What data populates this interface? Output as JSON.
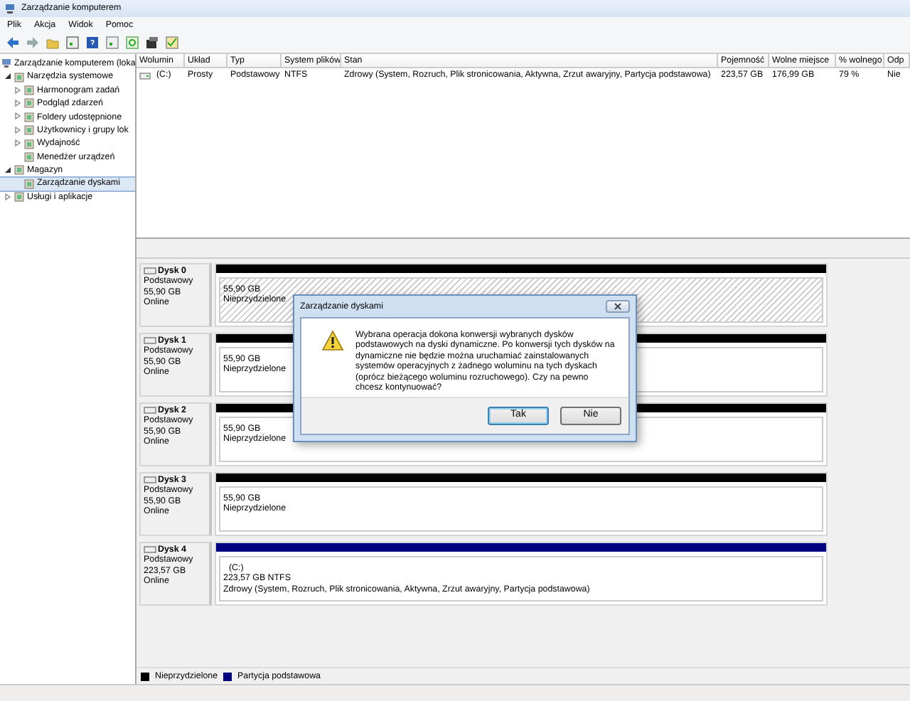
{
  "window": {
    "title": "Zarządzanie komputerem"
  },
  "menu": [
    "Plik",
    "Akcja",
    "Widok",
    "Pomoc"
  ],
  "tree": [
    {
      "label": "Zarządzanie komputerem (loka",
      "kind": "root",
      "selected": false,
      "children": [
        {
          "label": "Narzędzia systemowe",
          "kind": "group",
          "expanded": true,
          "selected": false,
          "children": [
            {
              "label": "Harmonogram zadań",
              "kind": "group",
              "expanded": false,
              "selected": false
            },
            {
              "label": "Podgląd zdarzeń",
              "kind": "group",
              "expanded": false,
              "selected": false
            },
            {
              "label": "Foldery udostępnione",
              "kind": "group",
              "expanded": false,
              "selected": false
            },
            {
              "label": "Użytkownicy i grupy lok",
              "kind": "group",
              "expanded": false,
              "selected": false
            },
            {
              "label": "Wydajność",
              "kind": "group",
              "expanded": false,
              "selected": false
            },
            {
              "label": "Menedżer urządzeń",
              "kind": "leaf",
              "selected": false
            }
          ]
        },
        {
          "label": "Magazyn",
          "kind": "group",
          "expanded": true,
          "selected": false,
          "children": [
            {
              "label": "Zarządzanie dyskami",
              "kind": "leaf",
              "selected": true
            }
          ]
        },
        {
          "label": "Usługi i aplikacje",
          "kind": "group",
          "expanded": false,
          "selected": false
        }
      ]
    }
  ],
  "table": {
    "columns": [
      "Wolumin",
      "Układ",
      "Typ",
      "System plików",
      "Stan",
      "Pojemność",
      "Wolne miejsce",
      "% wolnego",
      "Odp"
    ],
    "rows": [
      [
        "(C:)",
        "Prosty",
        "Podstawowy",
        "NTFS",
        "Zdrowy (System, Rozruch, Plik stronicowania, Aktywna, Zrzut awaryjny, Partycja podstawowa)",
        "223,57 GB",
        "176,99 GB",
        "79 %",
        "Nie"
      ]
    ]
  },
  "disks": [
    {
      "name": "Dysk 0",
      "type": "Podstawowy",
      "size": "55,90 GB",
      "status": "Online",
      "partition": {
        "kind": "unallocated",
        "selected": true,
        "lines": [
          "55,90 GB",
          "Nieprzydzielone"
        ]
      }
    },
    {
      "name": "Dysk 1",
      "type": "Podstawowy",
      "size": "55,90 GB",
      "status": "Online",
      "partition": {
        "kind": "unallocated",
        "selected": false,
        "lines": [
          "55,90 GB",
          "Nieprzydzielone"
        ]
      }
    },
    {
      "name": "Dysk 2",
      "type": "Podstawowy",
      "size": "55,90 GB",
      "status": "Online",
      "partition": {
        "kind": "unallocated",
        "selected": false,
        "lines": [
          "55,90 GB",
          "Nieprzydzielone"
        ]
      }
    },
    {
      "name": "Dysk 3",
      "type": "Podstawowy",
      "size": "55,90 GB",
      "status": "Online",
      "partition": {
        "kind": "unallocated",
        "selected": false,
        "lines": [
          "55,90 GB",
          "Nieprzydzielone"
        ]
      }
    },
    {
      "name": "Dysk 4",
      "type": "Podstawowy",
      "size": "223,57 GB",
      "status": "Online",
      "partition": {
        "kind": "primary",
        "selected": false,
        "lines": [
          "(C:)",
          "223,57 GB NTFS",
          "Zdrowy (System, Rozruch, Plik stronicowania, Aktywna, Zrzut awaryjny, Partycja podstawowa)"
        ]
      }
    }
  ],
  "legend": [
    {
      "label": "Nieprzydzielone",
      "color": "#000000"
    },
    {
      "label": "Partycja podstawowa",
      "color": "#000080"
    }
  ],
  "dialog": {
    "title": "Zarządzanie dyskami",
    "message": "Wybrana operacja dokona konwersji wybranych dysków podstawowych na dyski dynamiczne. Po konwersji tych dysków na dynamiczne nie będzie można uruchamiać zainstalowanych systemów operacyjnych z żadnego woluminu na tych dyskach (oprócz bieżącego woluminu rozruchowego). Czy na pewno chcesz kontynuować?",
    "buttons": [
      {
        "label": "Tak",
        "selected": true
      },
      {
        "label": "Nie",
        "selected": false
      }
    ]
  }
}
